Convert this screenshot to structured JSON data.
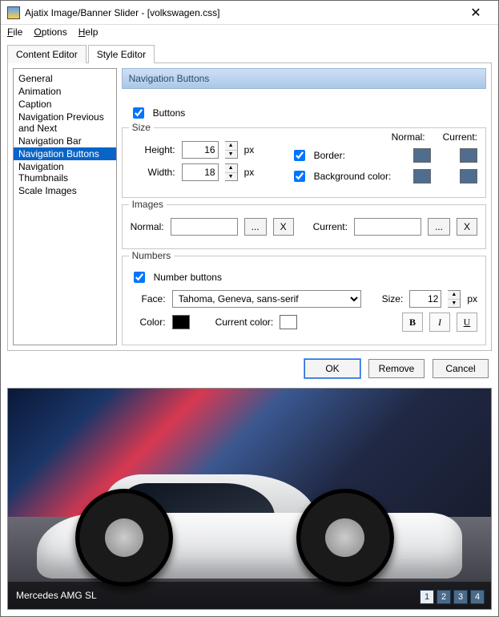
{
  "window": {
    "title": "Ajatix Image/Banner Slider - [volkswagen.css]"
  },
  "menu": {
    "file": "File",
    "options": "Options",
    "help": "Help"
  },
  "tabs": {
    "content": "Content Editor",
    "style": "Style Editor"
  },
  "tree": {
    "items": [
      "General",
      "Animation",
      "Caption",
      "Navigation Previous and Next",
      "Navigation Bar",
      "Navigation Buttons",
      "Navigation Thumbnails",
      "Scale Images"
    ],
    "selected_index": 5
  },
  "panel": {
    "title": "Navigation Buttons",
    "buttons_checked": true,
    "buttons_label": "Buttons",
    "size": {
      "legend": "Size",
      "height_label": "Height:",
      "height": "16",
      "width_label": "Width:",
      "width": "18",
      "px": "px",
      "normal_header": "Normal:",
      "current_header": "Current:",
      "border_label": "Border:",
      "border_checked": true,
      "bg_label": "Background color:",
      "bg_checked": true,
      "border_normal": "#4f6d8f",
      "border_current": "#4f6d8f",
      "bg_normal": "#4f6d8f",
      "bg_current": "#4f6d8f"
    },
    "images": {
      "legend": "Images",
      "normal_label": "Normal:",
      "current_label": "Current:",
      "normal_value": "",
      "current_value": "",
      "browse": "...",
      "clear": "X"
    },
    "numbers": {
      "legend": "Numbers",
      "nb_label": "Number buttons",
      "nb_checked": true,
      "face_label": "Face:",
      "face_value": "Tahoma, Geneva, sans-serif",
      "size_label": "Size:",
      "size_value": "12",
      "px": "px",
      "color_label": "Color:",
      "color": "#000000",
      "curcolor_label": "Current color:",
      "curcolor": "#ffffff",
      "bold": "B",
      "italic": "I",
      "underline": "U"
    }
  },
  "buttons": {
    "ok": "OK",
    "remove": "Remove",
    "cancel": "Cancel"
  },
  "preview": {
    "caption": "Mercedes AMG SL",
    "nav": [
      "1",
      "2",
      "3",
      "4"
    ],
    "current": 0
  }
}
